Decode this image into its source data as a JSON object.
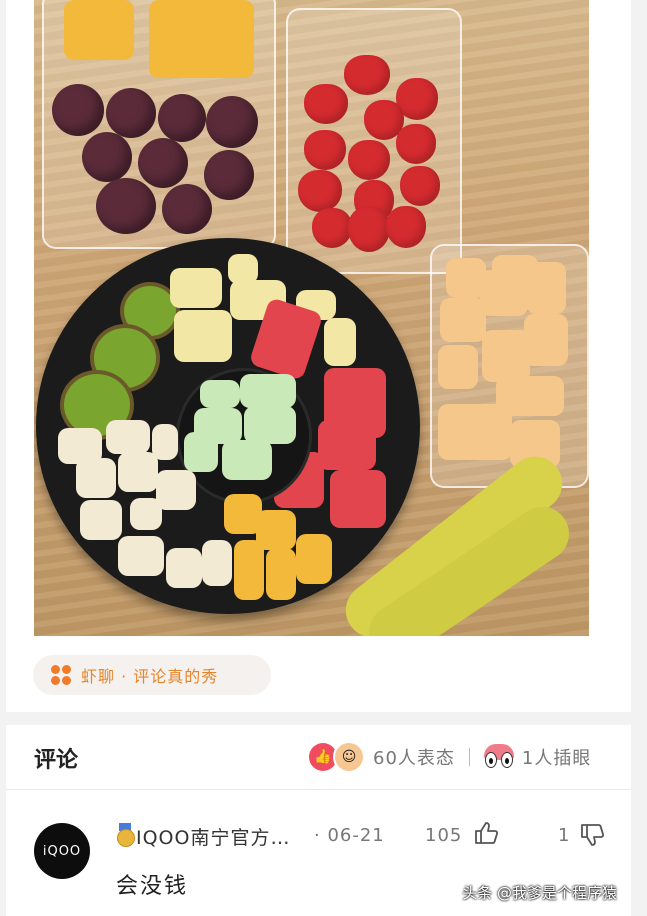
{
  "topic": {
    "label": "虾聊 · 评论真的秀",
    "accent": "#ef7b2b"
  },
  "comments_header": {
    "title": "评论",
    "reactions_count": "60人表态",
    "pokes_count": "1人插眼"
  },
  "comment": {
    "avatar_text": "iQOO",
    "username": "IQOO南宁官方…",
    "date": "· 06-21",
    "likes": "105",
    "dislikes": "1",
    "text": "会没钱",
    "watermark": "头条 @我爹是个程序猿"
  },
  "icons": [
    "topic-icon",
    "like-icon",
    "smile-emoji-icon",
    "eyes-icon",
    "medal-icon",
    "thumb-up-icon",
    "thumb-down-icon"
  ]
}
